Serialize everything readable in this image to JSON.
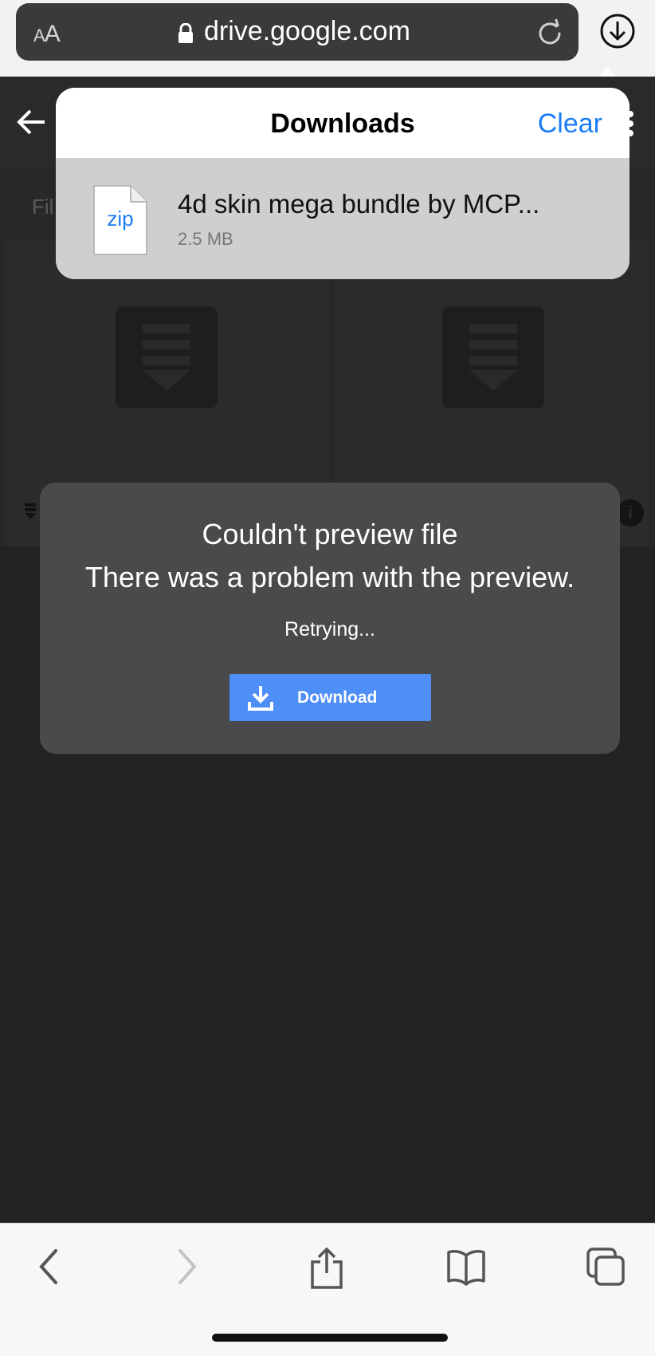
{
  "browser": {
    "reader_label_small": "A",
    "reader_label_large": "A",
    "url": "drive.google.com"
  },
  "drive": {
    "behind_label": "Fil"
  },
  "downloads": {
    "title": "Downloads",
    "clear_label": "Clear",
    "items": [
      {
        "file_type": "zip",
        "name": "4d skin mega bundle by MCP...",
        "size": "2.5 MB"
      }
    ]
  },
  "preview_dialog": {
    "title": "Couldn't preview file",
    "message": "There was a problem with the preview.",
    "status": "Retrying...",
    "download_label": "Download"
  },
  "toolbar": {
    "icons": [
      "back-icon",
      "forward-icon",
      "share-icon",
      "bookmarks-icon",
      "tabs-icon"
    ]
  },
  "colors": {
    "accent": "#1a7cf5",
    "download_button": "#4d8ef7",
    "dialog_bg": "#4a494c",
    "page_bg": "#232323"
  }
}
